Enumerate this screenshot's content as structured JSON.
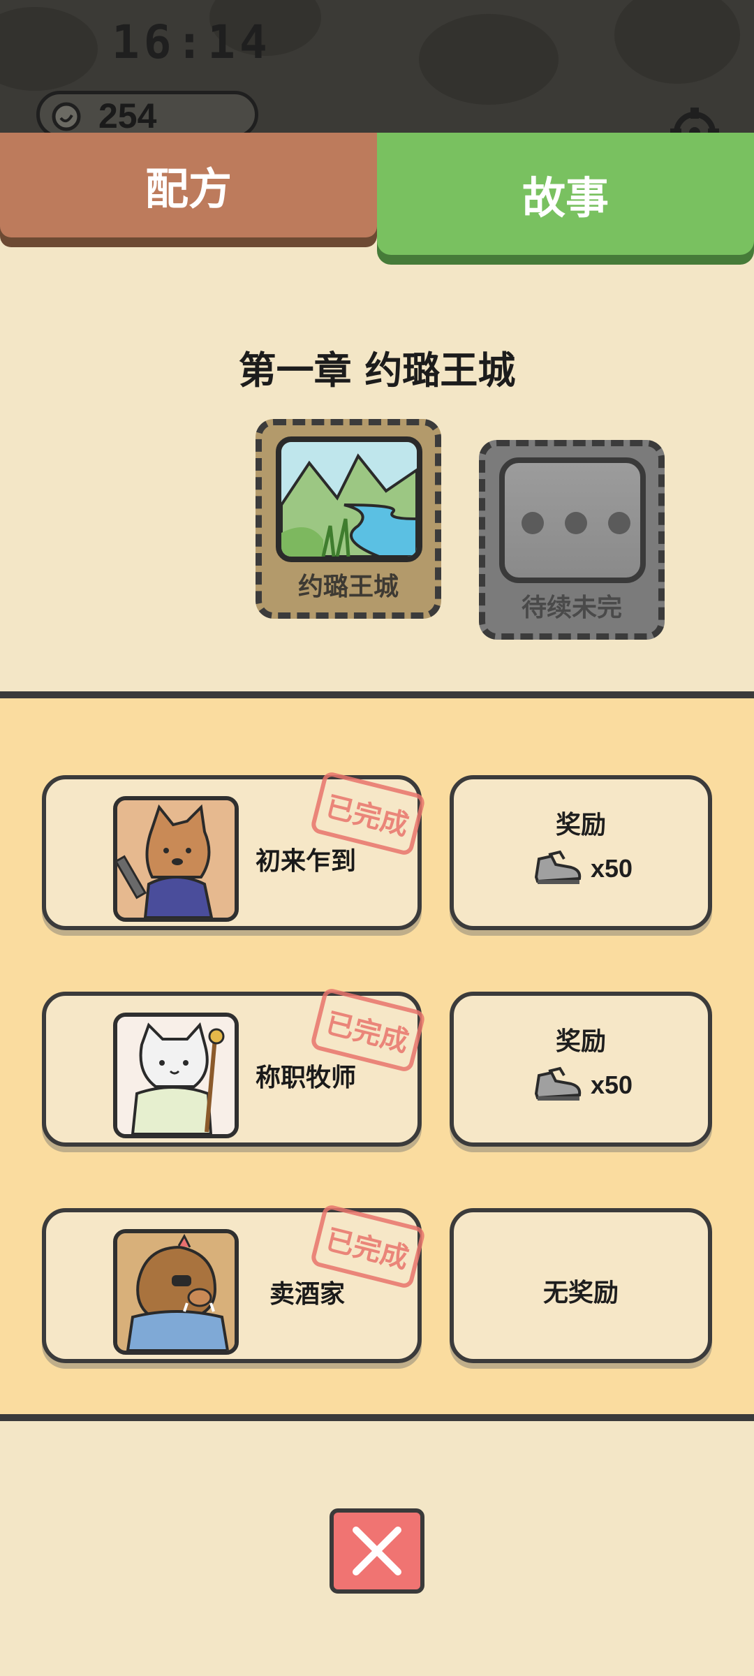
{
  "status": {
    "time": "16:14"
  },
  "currency": {
    "icon": "coin-icon",
    "value": "254"
  },
  "tabs": [
    {
      "label": "配方",
      "color": "#bd7b5c"
    },
    {
      "label": "故事",
      "color": "#79c160",
      "selected": true
    }
  ],
  "chapter": {
    "title": "第一章 约璐王城",
    "cards": [
      {
        "label": "约璐王城",
        "state": "unlocked"
      },
      {
        "label": "待续未完",
        "state": "locked"
      }
    ]
  },
  "quests": [
    {
      "name": "初来乍到",
      "stamp": "已完成",
      "portrait": "fox-portrait",
      "reward_title": "奖励",
      "reward_icon": "shoe-icon",
      "reward_qty": "x50"
    },
    {
      "name": "称职牧师",
      "stamp": "已完成",
      "portrait": "cat-portrait",
      "reward_title": "奖励",
      "reward_icon": "shoe-icon",
      "reward_qty": "x50"
    },
    {
      "name": "卖酒家",
      "stamp": "已完成",
      "portrait": "boar-portrait",
      "reward_text": "无奖励"
    }
  ],
  "close": {
    "icon": "close-icon",
    "color": "#f07472"
  }
}
